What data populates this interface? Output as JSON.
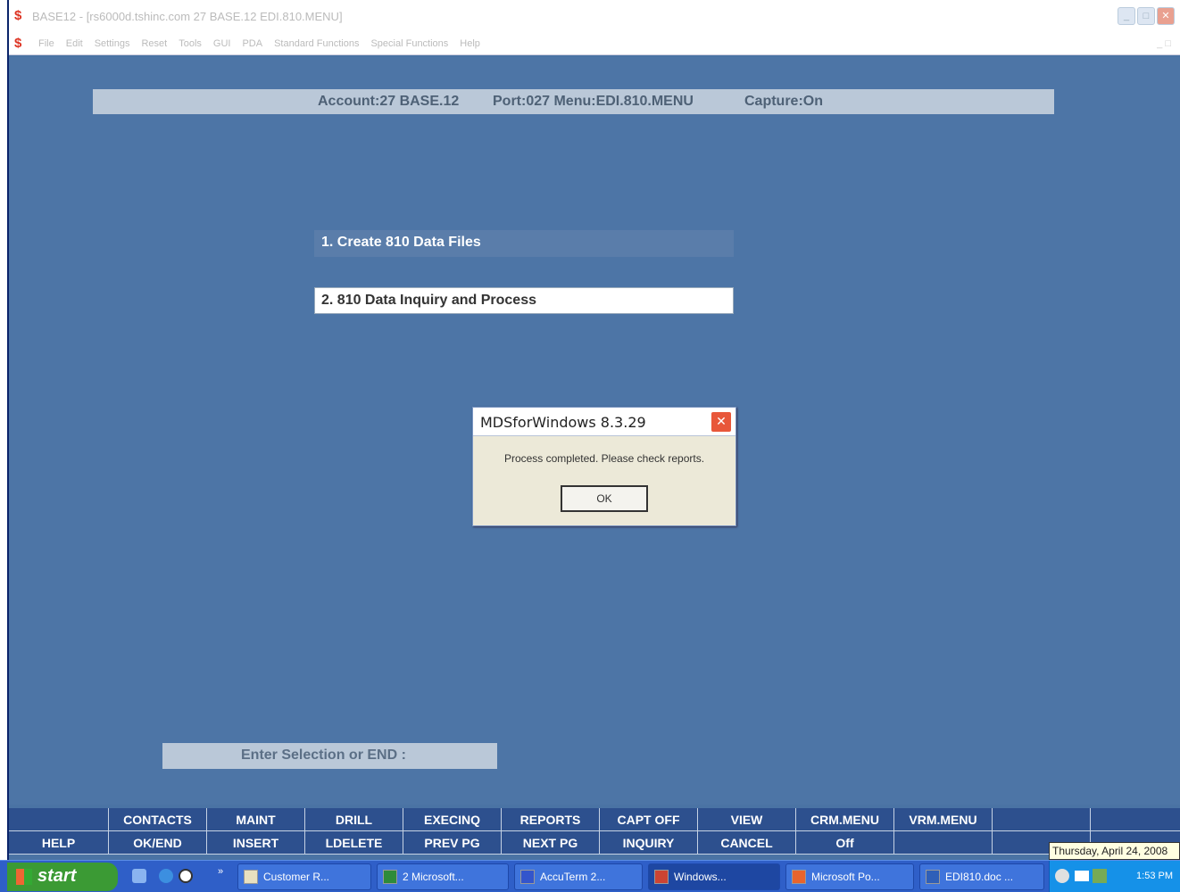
{
  "window": {
    "title": "BASE12 - [rs6000d.tshinc.com 27 BASE.12 EDI.810.MENU]",
    "menu": [
      "File",
      "Edit",
      "Settings",
      "Reset",
      "Tools",
      "GUI",
      "PDA",
      "Standard Functions",
      "Special Functions",
      "Help"
    ]
  },
  "status": {
    "account": "Account:27 BASE.12",
    "port_menu": "Port:027 Menu:EDI.810.MENU",
    "capture": "Capture:On"
  },
  "menu_options": [
    "1. Create 810 Data Files",
    "2. 810 Data Inquiry and Process"
  ],
  "prompt": "Enter Selection or END :",
  "dialog": {
    "title": "MDSforWindows 8.3.29",
    "message": "Process completed.  Please check reports.",
    "ok_label": "OK",
    "close_glyph": "✕"
  },
  "fkeys": {
    "row1": [
      "",
      "CONTACTS",
      "MAINT",
      "DRILL",
      "EXECINQ",
      "REPORTS",
      "CAPT OFF",
      "VIEW",
      "CRM.MENU",
      "VRM.MENU",
      "",
      ""
    ],
    "row2": [
      "HELP",
      "OK/END",
      "INSERT",
      "LDELETE",
      "PREV PG",
      "NEXT PG",
      "INQUIRY",
      "CANCEL",
      "Off",
      "",
      "",
      ""
    ]
  },
  "taskbar": {
    "start": "start",
    "buttons": [
      "Customer R...",
      "2 Microsoft...",
      "AccuTerm 2...",
      "Windows...",
      "Microsoft Po...",
      "EDI810.doc ..."
    ],
    "clock": "1:53 PM",
    "tooltip": "Thursday, April 24, 2008"
  }
}
